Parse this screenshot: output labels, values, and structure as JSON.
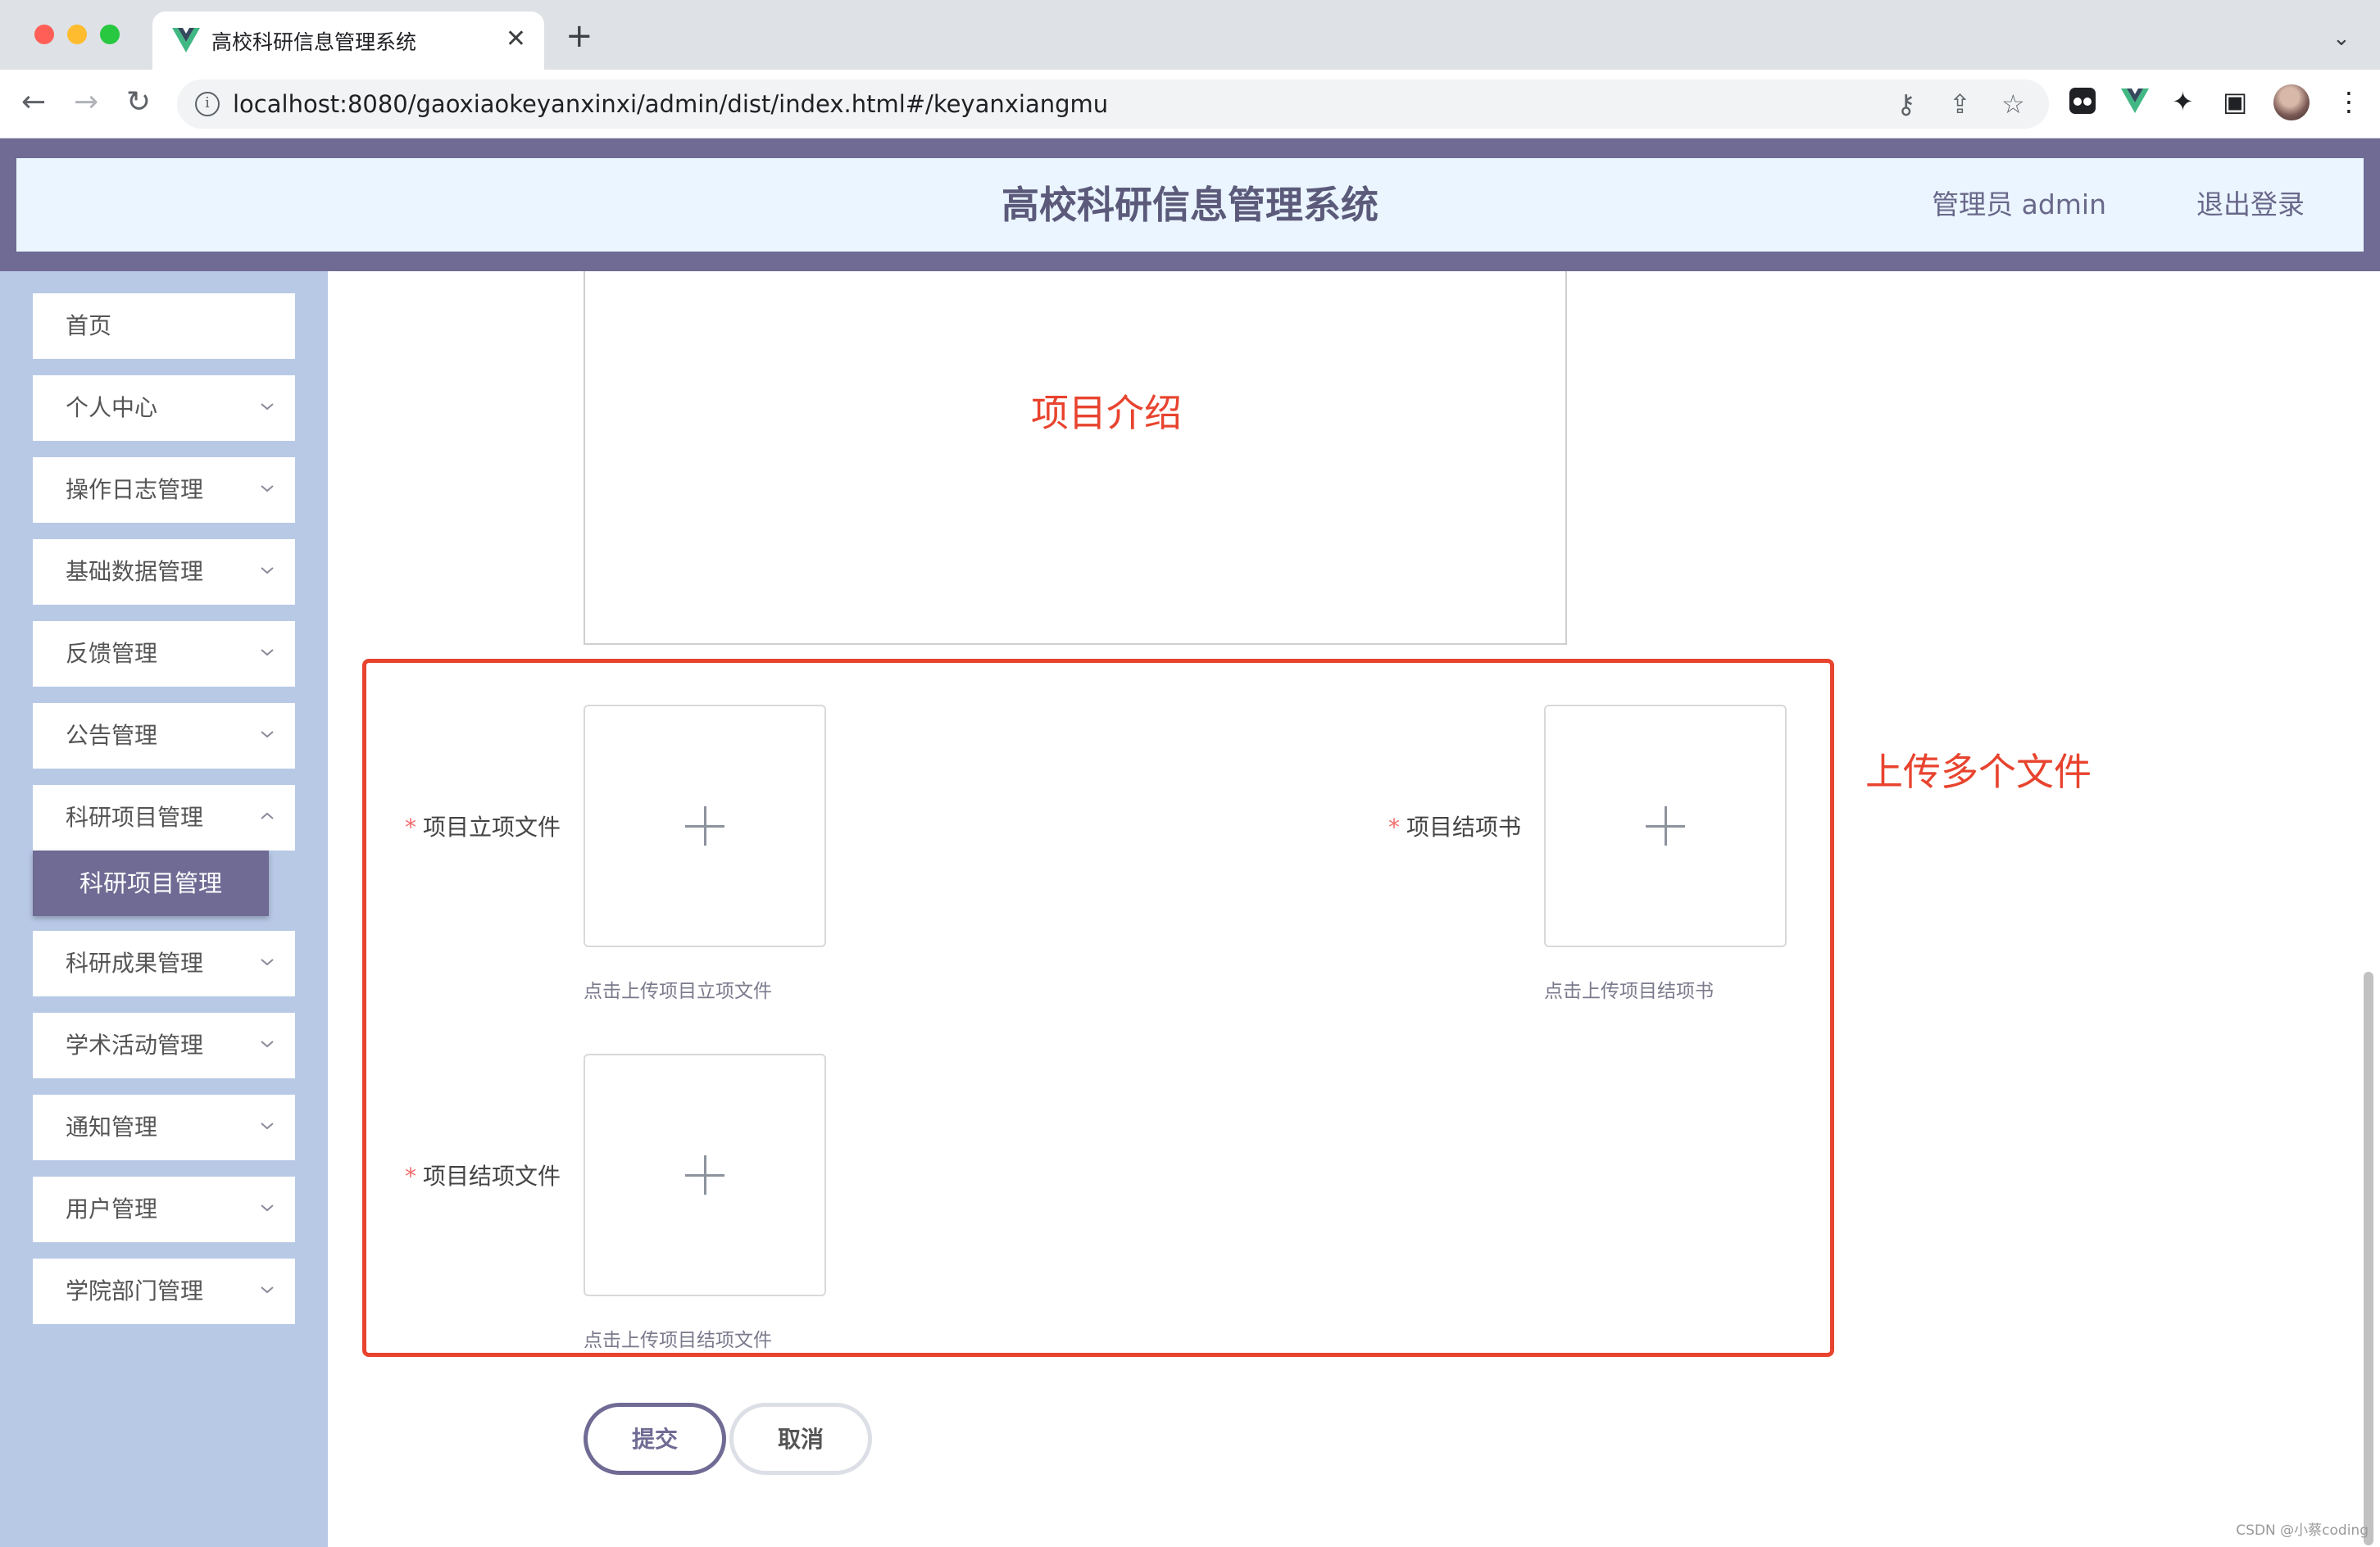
{
  "browser": {
    "tab_title": "高校科研信息管理系统",
    "tab_close": "✕",
    "new_tab": "+",
    "tab_menu": "⌄",
    "url": "localhost:8080/gaoxiaokeyanxinxi/admin/dist/index.html#/keyanxiangmu",
    "info_icon": "i",
    "nav": {
      "back": "←",
      "forward": "→",
      "reload": "↻"
    },
    "omni_icons": {
      "key": "⚷",
      "share": "⇪",
      "star": "☆"
    },
    "ext_icons": {
      "extension": "✦",
      "sidepanel": "▣",
      "menu": "⋮"
    }
  },
  "header": {
    "title": "高校科研信息管理系统",
    "user": "管理员 admin",
    "logout": "退出登录"
  },
  "sidebar": {
    "items": [
      {
        "label": "首页",
        "chevron": false
      },
      {
        "label": "个人中心",
        "chevron": true
      },
      {
        "label": "操作日志管理",
        "chevron": true
      },
      {
        "label": "基础数据管理",
        "chevron": true
      },
      {
        "label": "反馈管理",
        "chevron": true
      },
      {
        "label": "公告管理",
        "chevron": true
      },
      {
        "label": "科研项目管理",
        "chevron": true
      },
      {
        "label": "科研成果管理",
        "chevron": true
      },
      {
        "label": "学术活动管理",
        "chevron": true
      },
      {
        "label": "通知管理",
        "chevron": true
      },
      {
        "label": "用户管理",
        "chevron": true
      },
      {
        "label": "学院部门管理",
        "chevron": true
      }
    ],
    "active_sub": "科研项目管理"
  },
  "annotations": {
    "intro": "项目介绍",
    "upload_multi": "上传多个文件"
  },
  "form": {
    "required_mark": "*",
    "approval_label": "项目立项文件",
    "approval_tip": "点击上传项目立项文件",
    "conclusion_label": "项目结项书",
    "conclusion_tip": "点击上传项目结项书",
    "closing_label": "项目结项文件",
    "closing_tip": "点击上传项目结项文件",
    "submit": "提交",
    "cancel": "取消"
  },
  "watermark": "CSDN @小蔡coding",
  "colors": {
    "accent": "#6f6b94",
    "sidebar_bg": "#b8c9e6",
    "header_bg": "#eaf5ff",
    "annotation_red": "#e8432e",
    "required_red": "#f56c6c"
  }
}
